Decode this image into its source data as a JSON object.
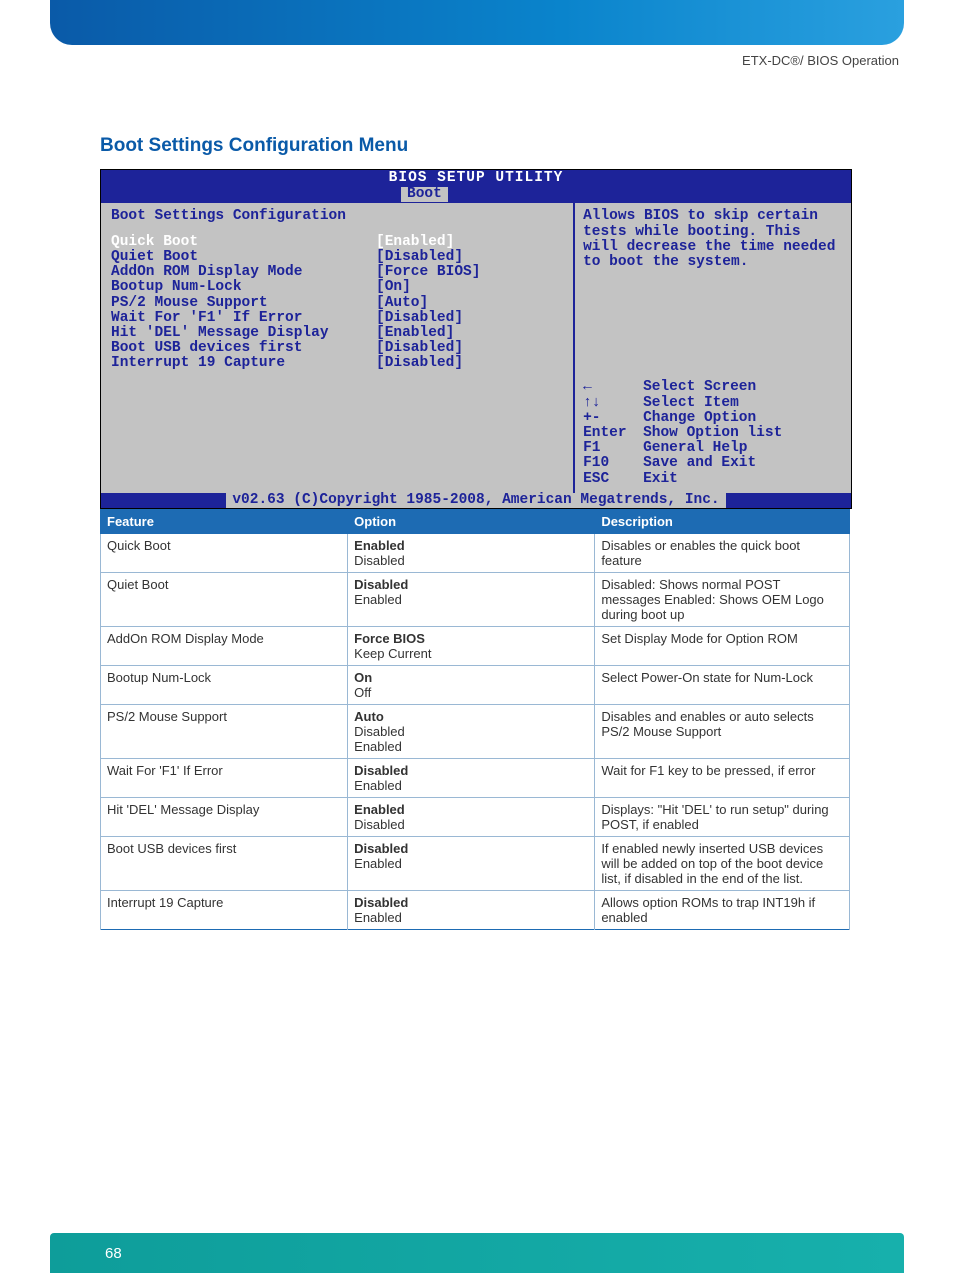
{
  "header": {
    "label": "ETX-DC®/ BIOS Operation"
  },
  "section": {
    "title": "Boot Settings Configuration Menu"
  },
  "bios": {
    "title": "BIOS SETUP UTILITY",
    "tab": "Boot",
    "heading": "Boot Settings Configuration",
    "items": [
      {
        "label": "Quick Boot",
        "value": "[Enabled]",
        "selected": true
      },
      {
        "label": "Quiet Boot",
        "value": "[Disabled]"
      },
      {
        "label": "AddOn ROM Display Mode",
        "value": "[Force BIOS]"
      },
      {
        "label": "Bootup Num-Lock",
        "value": "[On]"
      },
      {
        "label": "PS/2 Mouse Support",
        "value": "[Auto]"
      },
      {
        "label": "Wait For 'F1' If Error",
        "value": "[Disabled]"
      },
      {
        "label": "Hit 'DEL' Message Display",
        "value": "[Enabled]"
      },
      {
        "label": "Boot USB devices first",
        "value": "[Disabled]"
      },
      {
        "label": "Interrupt 19 Capture",
        "value": "[Disabled]"
      }
    ],
    "help": "Allows BIOS to skip certain tests while booting. This will decrease the time needed to boot the system.",
    "nav": [
      {
        "key": "←",
        "label": "Select Screen"
      },
      {
        "key": "↑↓",
        "label": "Select Item"
      },
      {
        "key": "+-",
        "label": "Change Option"
      },
      {
        "key": "Enter",
        "label": "Show Option list"
      },
      {
        "key": "F1",
        "label": "General Help"
      },
      {
        "key": "F10",
        "label": "Save and Exit"
      },
      {
        "key": "ESC",
        "label": "Exit"
      }
    ],
    "footer": "v02.63 (C)Copyright 1985-2008, American Megatrends, Inc."
  },
  "table": {
    "headers": {
      "feature": "Feature",
      "option": "Option",
      "description": "Description"
    },
    "rows": [
      {
        "feature": "Quick Boot",
        "default": "Enabled",
        "others": [
          "Disabled"
        ],
        "desc": "Disables or enables the quick boot feature"
      },
      {
        "feature": "Quiet Boot",
        "default": "Disabled",
        "others": [
          "Enabled"
        ],
        "desc": "Disabled: Shows normal POST messages Enabled: Shows OEM Logo during boot up"
      },
      {
        "feature": "AddOn ROM Display Mode",
        "default": "Force BIOS",
        "others": [
          "Keep Current"
        ],
        "desc": "Set Display Mode for Option ROM"
      },
      {
        "feature": "Bootup Num-Lock",
        "default": "On",
        "others": [
          "Off"
        ],
        "desc": "Select Power-On state for Num-Lock"
      },
      {
        "feature": "PS/2 Mouse Support",
        "default": "Auto",
        "others": [
          "Disabled",
          "Enabled"
        ],
        "desc": "Disables and enables or auto selects PS/2 Mouse Support"
      },
      {
        "feature": "Wait For 'F1' If Error",
        "default": "Disabled",
        "others": [
          "Enabled"
        ],
        "desc": "Wait for F1 key to be pressed, if error"
      },
      {
        "feature": "Hit 'DEL' Message Display",
        "default": "Enabled",
        "others": [
          "Disabled"
        ],
        "desc": "Displays: \"Hit 'DEL' to run setup\" during POST, if enabled"
      },
      {
        "feature": "Boot USB devices first",
        "default": "Disabled",
        "others": [
          "Enabled"
        ],
        "desc": "If enabled newly inserted USB devices will be added on top of the boot device list, if disabled in the end of the list."
      },
      {
        "feature": "Interrupt 19 Capture",
        "default": "Disabled",
        "others": [
          "Enabled"
        ],
        "desc": "Allows option ROMs to trap INT19h if enabled"
      }
    ]
  },
  "footer": {
    "page_number": "68"
  }
}
